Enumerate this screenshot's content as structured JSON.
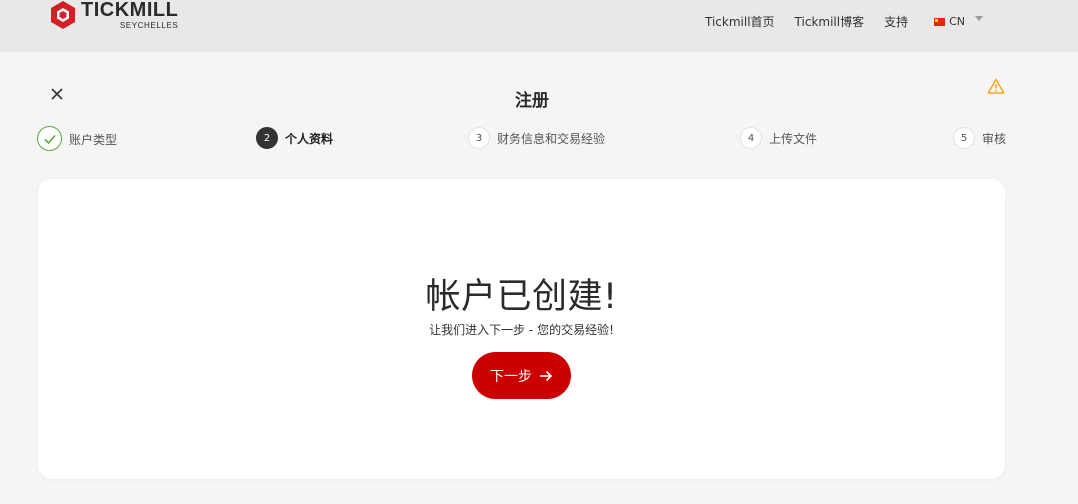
{
  "brand": {
    "name": "TICKMILL",
    "region": "SEYCHELLES",
    "color": "#d41f26"
  },
  "nav": {
    "home": "Tickmill首页",
    "blog": "Tickmill博客",
    "support": "支持",
    "language": "CN"
  },
  "wizard": {
    "title": "注册",
    "steps": [
      {
        "number": "",
        "label": "账户类型",
        "state": "done"
      },
      {
        "number": "2",
        "label": "个人资料",
        "state": "active"
      },
      {
        "number": "3",
        "label": "财务信息和交易经验",
        "state": "pending"
      },
      {
        "number": "4",
        "label": "上传文件",
        "state": "pending"
      },
      {
        "number": "5",
        "label": "审核",
        "state": "pending"
      }
    ]
  },
  "card": {
    "heading": "帐户已创建!",
    "subtext": "让我们进入下一步 - 您的交易经验!",
    "next_label": "下一步"
  },
  "colors": {
    "accent": "#cc0000",
    "success": "#59a93a",
    "warning": "#f5a623"
  },
  "icons": [
    "close-icon",
    "warning-icon",
    "check-icon",
    "arrow-right-icon",
    "china-flag-icon",
    "chevron-down-icon"
  ]
}
